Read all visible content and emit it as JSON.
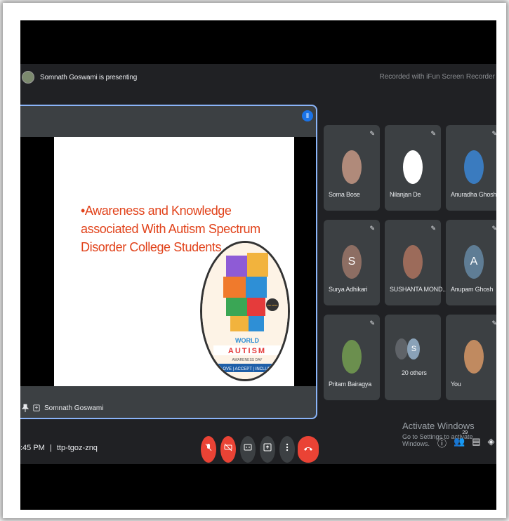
{
  "topbar": {
    "presenter_text": "Somnath Goswami is presenting",
    "recording_text": "Recorded with iFun Screen Recorder"
  },
  "slide": {
    "line1": "•Awareness and Knowledge",
    "line2": "associated With Autism Spectrum",
    "line3": "Disorder College Students",
    "logo_text_top": "WORLD",
    "logo_text_main": "AUTISM",
    "logo_text_sub": "AWARENESS DAY",
    "logo_text_ribbon": "LOVE | ACCEPT | INCLUDE",
    "logo_tag": "2ND APRIL"
  },
  "presenter_tile": {
    "name": "Somnath Goswami"
  },
  "participants": [
    {
      "name": "Soma Bose",
      "avatar": "photo",
      "color": "#b08a7a"
    },
    {
      "name": "Nilanjan De",
      "avatar": "blank",
      "color": "#ffffff"
    },
    {
      "name": "Anuradha Ghosh",
      "avatar": "photo",
      "color": "#3a7bbf"
    },
    {
      "name": "Surya Adhikari",
      "avatar": "letter",
      "letter": "S",
      "color": "#8d6e63"
    },
    {
      "name": "SUSHANTA MOND...",
      "avatar": "photo",
      "color": "#9c6b5a"
    },
    {
      "name": "Anupam Ghosh",
      "avatar": "letter",
      "letter": "A",
      "color": "#5f7d95"
    },
    {
      "name": "Pritam Bairagya",
      "avatar": "photo",
      "color": "#6b8f4e"
    },
    {
      "name": "20 others",
      "avatar": "group",
      "letter": "S",
      "color": "#5f6368"
    },
    {
      "name": "You",
      "avatar": "photo",
      "color": "#c08a60"
    }
  ],
  "bottom": {
    "time_text": ":45 PM",
    "meeting_code": "ttp-tgoz-znq",
    "separator": "|",
    "activate_title": "Activate Windows",
    "activate_sub": "Go to Settings to activate Windows.",
    "people_count": "29"
  },
  "colors": {
    "accent_blue": "#8ab4f8",
    "danger_red": "#ea4335",
    "slide_text": "#e1421a",
    "tile_bg": "#3c4043"
  }
}
